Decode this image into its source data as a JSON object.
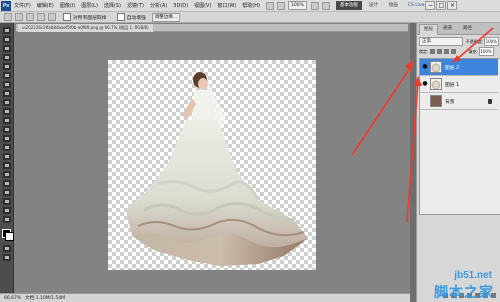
{
  "app": {
    "logo": "Ps",
    "menu": [
      "文件(F)",
      "编辑(E)",
      "图像(I)",
      "图层(L)",
      "选择(S)",
      "滤镜(T)",
      "分析(A)",
      "3D(D)",
      "视图(V)",
      "窗口(W)",
      "帮助(H)"
    ],
    "zoom": "100%",
    "workspaces": [
      "基本功能",
      "设计",
      "绘画"
    ],
    "cs_live": "CS Live",
    "window_buttons": [
      "−",
      "□",
      "×"
    ]
  },
  "options_bar": {
    "sample_all_layers": "对所有图层取样",
    "auto_enhance": "自动增强",
    "refine_edge": "调整边缘..."
  },
  "document": {
    "tab_label": "ui202126c2ffab8daaef5f0b-e0f89.png @ 66.7% (图层 1, RGB/8)"
  },
  "status": {
    "zoom": "66.67%",
    "doc_size": "文档:1.10M/1.54M"
  },
  "layers_panel": {
    "tabs": [
      "图层",
      "通道",
      "路径"
    ],
    "blend_mode": "正常",
    "opacity_label": "不透明度:",
    "opacity_value": "100%",
    "lock_label": "锁定:",
    "fill_label": "填充:",
    "fill_value": "100%",
    "layers": [
      {
        "name": "图层 2",
        "selected": true
      },
      {
        "name": "图层 1",
        "selected": false
      },
      {
        "name": "背景",
        "selected": false,
        "locked": true
      }
    ]
  },
  "watermark": {
    "url": "jb51.net",
    "name": "脚本之家"
  },
  "colors": {
    "selection": "#3d85dc",
    "arrow": "#ef3b2b"
  }
}
